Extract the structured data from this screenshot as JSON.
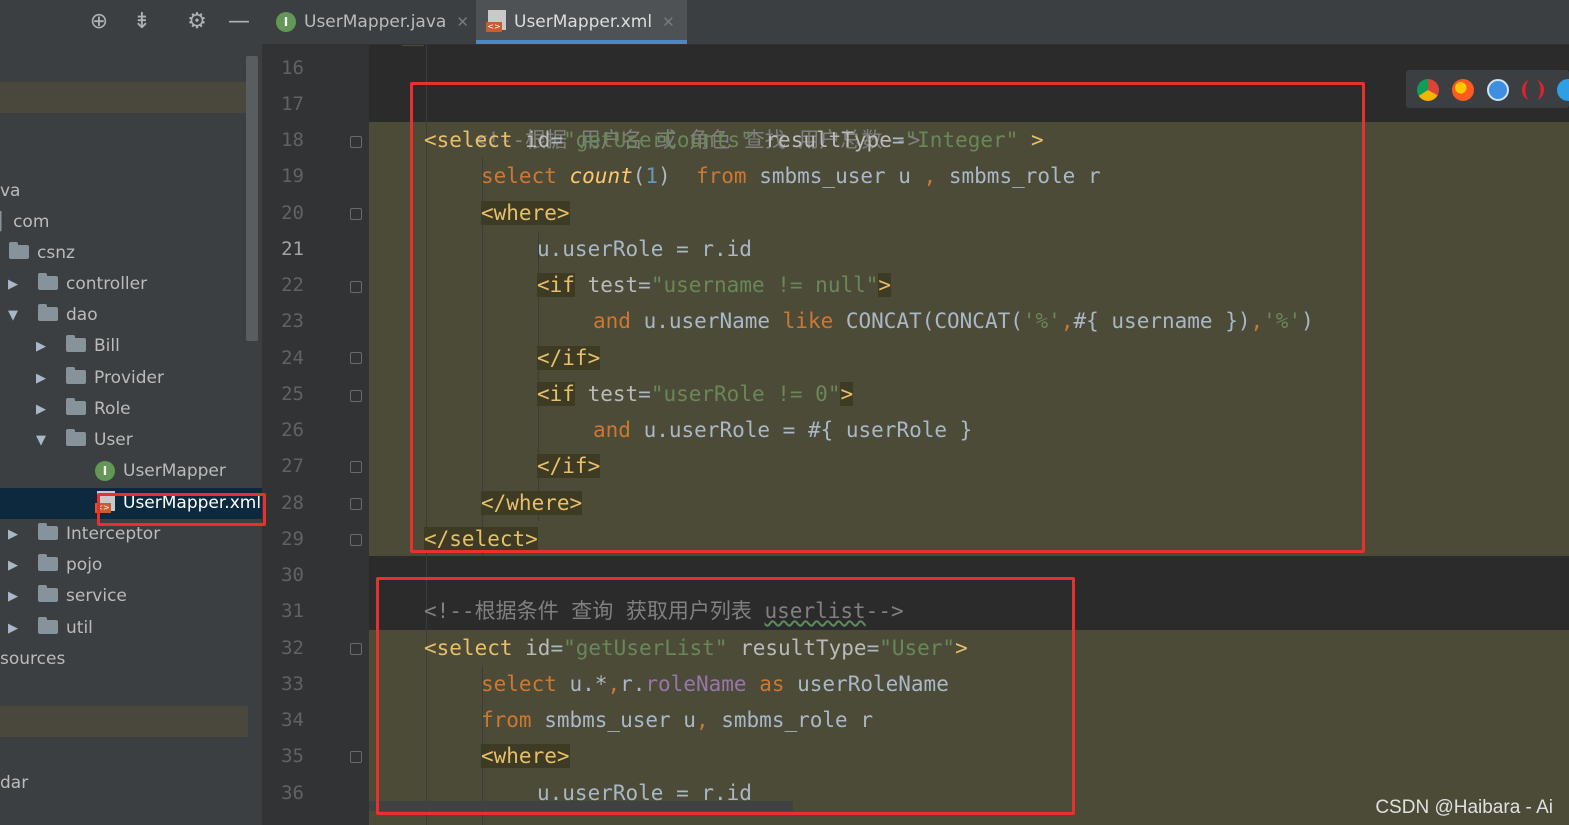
{
  "tabs": [
    {
      "label": "UserMapper.java",
      "icon": "interface-icon",
      "active": false
    },
    {
      "label": "UserMapper.xml",
      "icon": "xml-file-icon",
      "active": true
    }
  ],
  "toolbar": {
    "icons": [
      "locate-icon",
      "collapse-icon",
      "gear-icon",
      "minimize-icon"
    ]
  },
  "tree": {
    "java_label": "va",
    "com_label": "com",
    "csnz_label": "csnz",
    "controller_label": "controller",
    "dao_label": "dao",
    "bill_label": "Bill",
    "provider_label": "Provider",
    "role_label": "Role",
    "user_label": "User",
    "usermapper_label": "UserMapper",
    "usermapperxml_label": "UserMapper.xml",
    "interceptor_label": "Interceptor",
    "pojo_label": "pojo",
    "service_label": "service",
    "util_label": "util",
    "resources_label": "sources",
    "dar_label": "dar"
  },
  "gutter": {
    "lines": [
      "16",
      "17",
      "18",
      "19",
      "20",
      "21",
      "22",
      "23",
      "24",
      "25",
      "26",
      "27",
      "28",
      "29",
      "30",
      "31",
      "32",
      "33",
      "34",
      "35",
      "36"
    ],
    "current_line": "21"
  },
  "code": {
    "l17_comment": "<!--根据 用户名 或 角色 查找 用户总数-->",
    "l18_open": "<select",
    "l18_id_attr": " id",
    "l18_eq1": "=",
    "l18_id_val": "\"getUserCounts\"",
    "l18_rt_attr": " resultType",
    "l18_eq2": "=",
    "l18_rt_val": "\"Integer\"",
    "l18_close": " >",
    "l19_select": "select ",
    "l19_count": "count",
    "l19_paren_open": "(",
    "l19_one": "1",
    "l19_paren_close": ")  ",
    "l19_from": "from",
    "l19_rest": " smbms_user u ",
    "l19_comma": ",",
    "l19_rest2": " smbms_role r",
    "l20_where": "<where>",
    "l21_text": "u.userRole = r.id",
    "l22_open": "<if",
    "l22_attr": " test",
    "l22_eq": "=",
    "l22_val": "\"username != null\"",
    "l22_close": ">",
    "l23_and": "and",
    "l23_mid": " u.userName ",
    "l23_like": "like",
    "l23_rest": " CONCAT(CONCAT(",
    "l23_pct1": "'%'",
    "l23_comma1": ",",
    "l23_expr": "#{ username })",
    "l23_comma2": ",",
    "l23_pct2": "'%'",
    "l23_end": ")",
    "l24_endif": "</if>",
    "l25_open": "<if",
    "l25_attr": " test",
    "l25_eq": "=",
    "l25_val": "\"userRole != 0\"",
    "l25_close": ">",
    "l26_and": "and",
    "l26_rest": " u.userRole = #{ userRole }",
    "l27_endif": "</if>",
    "l28_endwhere": "</where>",
    "l29_endselect": "</select>",
    "l31_comment_a": "<!--根据条件 查询 获取用户列表 ",
    "l31_comment_b": "userlist",
    "l31_comment_c": "-->",
    "l32_open": "<select",
    "l32_id_attr": " id",
    "l32_eq1": "=",
    "l32_id_val": "\"getUserList\"",
    "l32_rt_attr": " resultType",
    "l32_eq2": "=",
    "l32_rt_val": "\"User\"",
    "l32_close": ">",
    "l33_select": "select",
    "l33_mid": " u.*",
    "l33_comma": ",",
    "l33_r": "r.",
    "l33_field": "roleName",
    "l33_as": " as",
    "l33_rest": " userRoleName",
    "l34_from": "from",
    "l34_rest": " smbms_user u",
    "l34_comma": ",",
    "l34_rest2": " smbms_role r",
    "l35_where": "<where>",
    "l36_text": "u.userRole = r.id"
  },
  "browser_icons": [
    "chrome-icon",
    "firefox-icon",
    "safari-icon",
    "opera-icon",
    "edge-icon"
  ],
  "watermark": "CSDN @Haibara - Ai",
  "colors": {
    "annotation": "#e8302c",
    "active_tab_underline": "#4a88c7"
  }
}
